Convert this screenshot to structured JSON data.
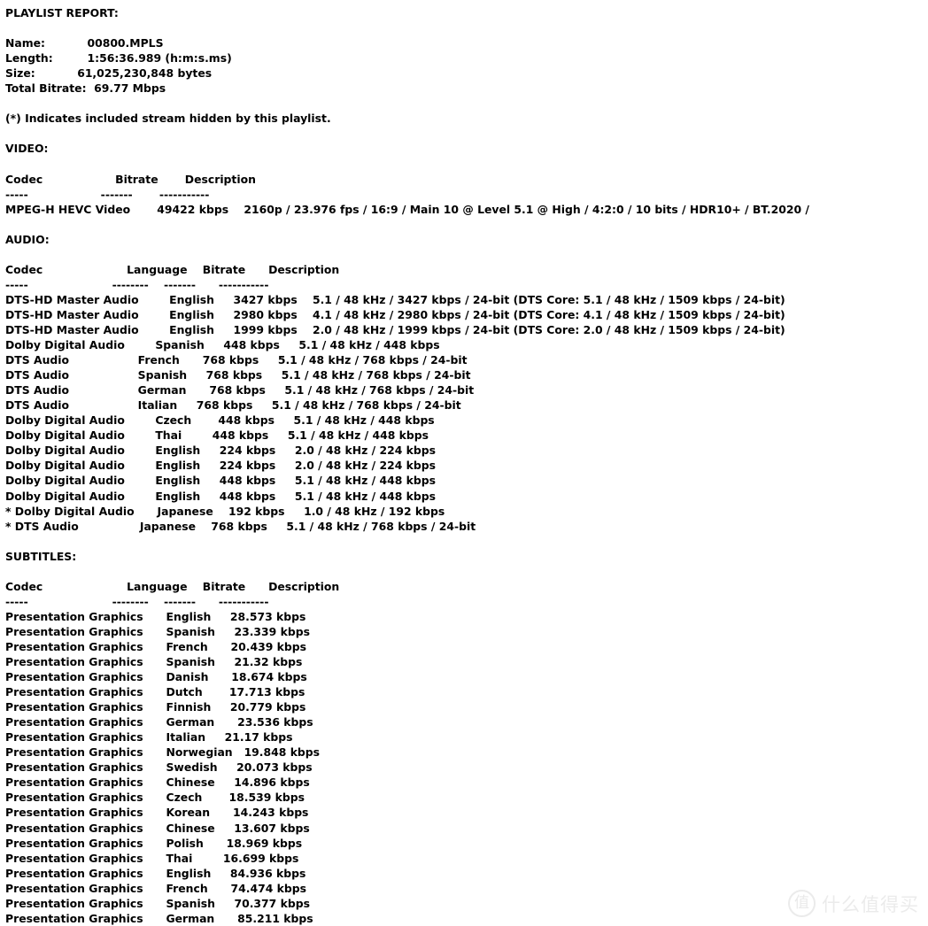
{
  "report": {
    "title": "PLAYLIST REPORT:",
    "summary": {
      "name_label": "Name:",
      "name_value": "00800.MPLS",
      "length_label": "Length:",
      "length_value": "1:56:36.989 (h:m:s.ms)",
      "size_label": "Size:",
      "size_value": "61,025,230,848 bytes",
      "total_bitrate_label": "Total Bitrate:",
      "total_bitrate_value": "69.77 Mbps"
    },
    "footnote": "(*) Indicates included stream hidden by this playlist.",
    "video": {
      "heading": "VIDEO:",
      "columns": [
        "Codec",
        "Bitrate",
        "Description"
      ],
      "rules": [
        "-----",
        "-------",
        "-----------"
      ],
      "rows": [
        {
          "codec": "MPEG-H HEVC Video",
          "bitrate": "49422 kbps",
          "description": "2160p / 23.976 fps / 16:9 / Main 10 @ Level 5.1 @ High / 4:2:0 / 10 bits / HDR10+ / BT.2020 /"
        }
      ]
    },
    "audio": {
      "heading": "AUDIO:",
      "columns": [
        "Codec",
        "Language",
        "Bitrate",
        "Description"
      ],
      "rules": [
        "-----",
        "--------",
        "-------",
        "-----------"
      ],
      "rows": [
        {
          "codec": "DTS-HD Master Audio",
          "language": "English",
          "bitrate": "3427 kbps",
          "description": "5.1 / 48 kHz / 3427 kbps / 24-bit (DTS Core: 5.1 / 48 kHz / 1509 kbps / 24-bit)"
        },
        {
          "codec": "DTS-HD Master Audio",
          "language": "English",
          "bitrate": "2980 kbps",
          "description": "4.1 / 48 kHz / 2980 kbps / 24-bit (DTS Core: 4.1 / 48 kHz / 1509 kbps / 24-bit)"
        },
        {
          "codec": "DTS-HD Master Audio",
          "language": "English",
          "bitrate": "1999 kbps",
          "description": "2.0 / 48 kHz / 1999 kbps / 24-bit (DTS Core: 2.0 / 48 kHz / 1509 kbps / 24-bit)"
        },
        {
          "codec": "Dolby Digital Audio",
          "language": "Spanish",
          "bitrate": "448 kbps",
          "description": "5.1 / 48 kHz / 448 kbps"
        },
        {
          "codec": "DTS Audio",
          "language": "French",
          "bitrate": "768 kbps",
          "description": "5.1 / 48 kHz / 768 kbps / 24-bit"
        },
        {
          "codec": "DTS Audio",
          "language": "Spanish",
          "bitrate": "768 kbps",
          "description": "5.1 / 48 kHz / 768 kbps / 24-bit"
        },
        {
          "codec": "DTS Audio",
          "language": "German",
          "bitrate": "768 kbps",
          "description": "5.1 / 48 kHz / 768 kbps / 24-bit"
        },
        {
          "codec": "DTS Audio",
          "language": "Italian",
          "bitrate": "768 kbps",
          "description": "5.1 / 48 kHz / 768 kbps / 24-bit"
        },
        {
          "codec": "Dolby Digital Audio",
          "language": "Czech",
          "bitrate": "448 kbps",
          "description": "5.1 / 48 kHz / 448 kbps"
        },
        {
          "codec": "Dolby Digital Audio",
          "language": "Thai",
          "bitrate": "448 kbps",
          "description": "5.1 / 48 kHz / 448 kbps"
        },
        {
          "codec": "Dolby Digital Audio",
          "language": "English",
          "bitrate": "224 kbps",
          "description": "2.0 / 48 kHz / 224 kbps"
        },
        {
          "codec": "Dolby Digital Audio",
          "language": "English",
          "bitrate": "224 kbps",
          "description": "2.0 / 48 kHz / 224 kbps"
        },
        {
          "codec": "Dolby Digital Audio",
          "language": "English",
          "bitrate": "448 kbps",
          "description": "5.1 / 48 kHz / 448 kbps"
        },
        {
          "codec": "Dolby Digital Audio",
          "language": "English",
          "bitrate": "448 kbps",
          "description": "5.1 / 48 kHz / 448 kbps"
        },
        {
          "codec": "* Dolby Digital Audio",
          "language": "Japanese",
          "bitrate": "192 kbps",
          "description": "1.0 / 48 kHz / 192 kbps"
        },
        {
          "codec": "* DTS Audio",
          "language": "Japanese",
          "bitrate": "768 kbps",
          "description": "5.1 / 48 kHz / 768 kbps / 24-bit"
        }
      ]
    },
    "subtitles": {
      "heading": "SUBTITLES:",
      "columns": [
        "Codec",
        "Language",
        "Bitrate",
        "Description"
      ],
      "rules": [
        "-----",
        "--------",
        "-------",
        "-----------"
      ],
      "rows": [
        {
          "codec": "Presentation Graphics",
          "language": "English",
          "bitrate": "28.573 kbps",
          "description": ""
        },
        {
          "codec": "Presentation Graphics",
          "language": "Spanish",
          "bitrate": "23.339 kbps",
          "description": ""
        },
        {
          "codec": "Presentation Graphics",
          "language": "French",
          "bitrate": "20.439 kbps",
          "description": ""
        },
        {
          "codec": "Presentation Graphics",
          "language": "Spanish",
          "bitrate": "21.32 kbps",
          "description": ""
        },
        {
          "codec": "Presentation Graphics",
          "language": "Danish",
          "bitrate": "18.674 kbps",
          "description": ""
        },
        {
          "codec": "Presentation Graphics",
          "language": "Dutch",
          "bitrate": "17.713 kbps",
          "description": ""
        },
        {
          "codec": "Presentation Graphics",
          "language": "Finnish",
          "bitrate": "20.779 kbps",
          "description": ""
        },
        {
          "codec": "Presentation Graphics",
          "language": "German",
          "bitrate": "23.536 kbps",
          "description": ""
        },
        {
          "codec": "Presentation Graphics",
          "language": "Italian",
          "bitrate": "21.17 kbps",
          "description": ""
        },
        {
          "codec": "Presentation Graphics",
          "language": "Norwegian",
          "bitrate": "19.848 kbps",
          "description": ""
        },
        {
          "codec": "Presentation Graphics",
          "language": "Swedish",
          "bitrate": "20.073 kbps",
          "description": ""
        },
        {
          "codec": "Presentation Graphics",
          "language": "Chinese",
          "bitrate": "14.896 kbps",
          "description": ""
        },
        {
          "codec": "Presentation Graphics",
          "language": "Czech",
          "bitrate": "18.539 kbps",
          "description": ""
        },
        {
          "codec": "Presentation Graphics",
          "language": "Korean",
          "bitrate": "14.243 kbps",
          "description": ""
        },
        {
          "codec": "Presentation Graphics",
          "language": "Chinese",
          "bitrate": "13.607 kbps",
          "description": ""
        },
        {
          "codec": "Presentation Graphics",
          "language": "Polish",
          "bitrate": "18.969 kbps",
          "description": ""
        },
        {
          "codec": "Presentation Graphics",
          "language": "Thai",
          "bitrate": "16.699 kbps",
          "description": ""
        },
        {
          "codec": "Presentation Graphics",
          "language": "English",
          "bitrate": "84.936 kbps",
          "description": ""
        },
        {
          "codec": "Presentation Graphics",
          "language": "French",
          "bitrate": "74.474 kbps",
          "description": ""
        },
        {
          "codec": "Presentation Graphics",
          "language": "Spanish",
          "bitrate": "70.377 kbps",
          "description": ""
        },
        {
          "codec": "Presentation Graphics",
          "language": "German",
          "bitrate": "85.211 kbps",
          "description": ""
        }
      ]
    }
  },
  "watermark": {
    "badge_glyph": "值",
    "text": "什么值得买"
  }
}
